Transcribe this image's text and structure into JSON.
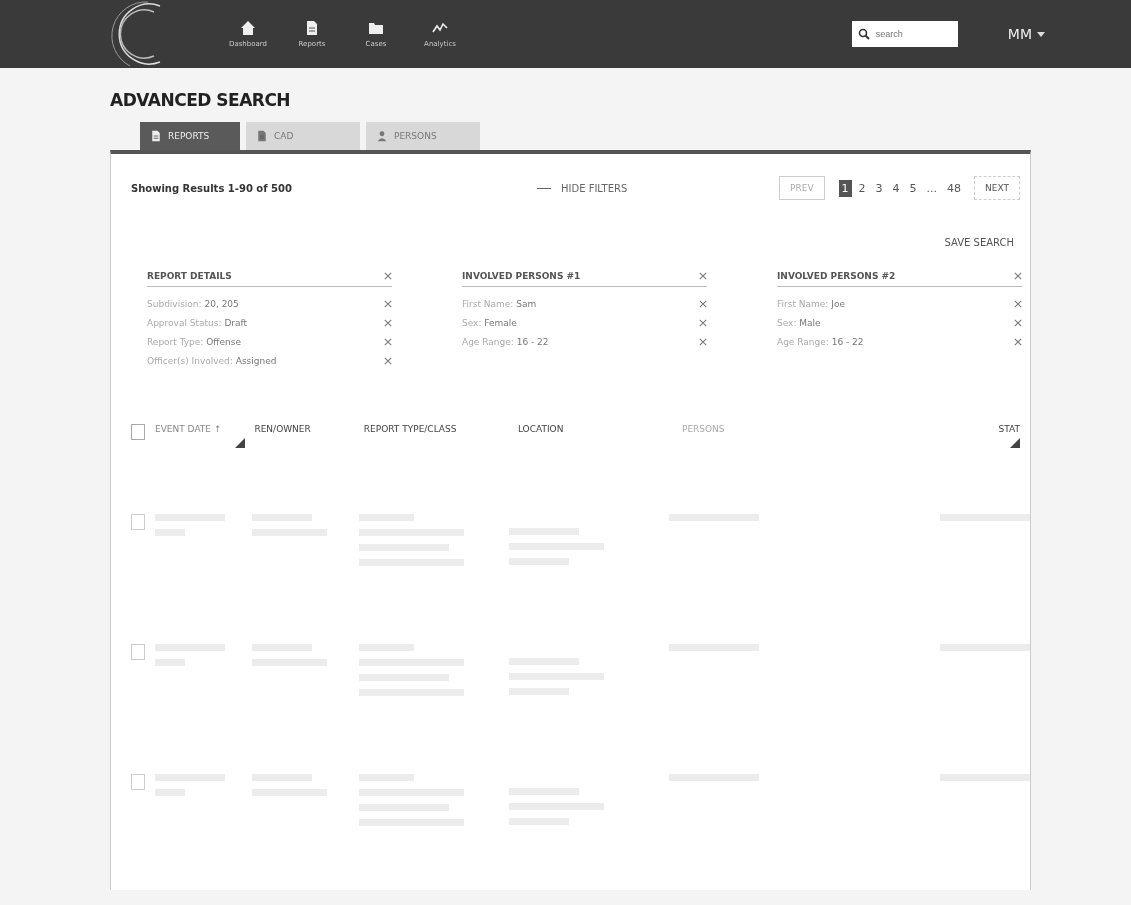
{
  "nav": {
    "items": [
      {
        "label": "Dashboard",
        "kind": "home"
      },
      {
        "label": "Reports",
        "kind": "doc"
      },
      {
        "label": "Cases",
        "kind": "folder"
      },
      {
        "label": "Analytics",
        "kind": "chart"
      }
    ],
    "search": {
      "placeholder": "search"
    },
    "user": {
      "initials": "MM"
    }
  },
  "title": "ADVANCED SEARCH",
  "tabs": [
    {
      "label": "REPORTS",
      "kind": "doc",
      "selected": true
    },
    {
      "label": "CAD",
      "kind": "doc",
      "selected": false
    },
    {
      "label": "PERSONS",
      "kind": "person",
      "selected": false
    }
  ],
  "results": "Showing Results 1-90 of 500",
  "hide_filters": "HIDE FILTERS",
  "pagination": {
    "prev": "PREV",
    "pages": [
      {
        "label": "1",
        "selected": true
      },
      {
        "label": "2",
        "selected": false
      },
      {
        "label": "3",
        "selected": false
      },
      {
        "label": "4",
        "selected": false
      },
      {
        "label": "5",
        "selected": false
      },
      {
        "label": "...",
        "selected": false
      },
      {
        "label": "48",
        "selected": false
      }
    ],
    "next": "NEXT"
  },
  "save_search": "SAVE SEARCH",
  "filter_groups": [
    {
      "title": "REPORT DETAILS",
      "items": [
        "Subdivision: **20, 205**",
        "Approval Status: **Draft**",
        "Report Type: **Offense**",
        "Officer(s) Involved: **Assigned**"
      ]
    },
    {
      "title": "INVOLVED PERSONS #1",
      "items": [
        "First Name: **Sam**",
        "Sex: **Female**",
        "Age Range: **16 - 22**"
      ]
    },
    {
      "title": "INVOLVED PERSONS #2",
      "items": [
        "First Name: **Joe**",
        "Sex: **Male**",
        "Age Range: **16 - 22**"
      ]
    }
  ],
  "table": {
    "columns": [
      {
        "label": "EVENT DATE ↑",
        "resizable": true
      },
      {
        "label": "REN/OWNER",
        "resizable": false
      },
      {
        "label": "REPORT TYPE/CLASS",
        "resizable": false
      },
      {
        "label": "LOCATION",
        "resizable": false
      },
      {
        "label": "PERSONS",
        "resizable": false
      },
      {
        "label": "STAT",
        "resizable": true
      }
    ],
    "select_all_checked": false,
    "rows": [
      {
        "kind": "illegible",
        "checked": false
      },
      {
        "kind": "illegible",
        "checked": false
      },
      {
        "kind": "illegible",
        "checked": false
      }
    ]
  }
}
